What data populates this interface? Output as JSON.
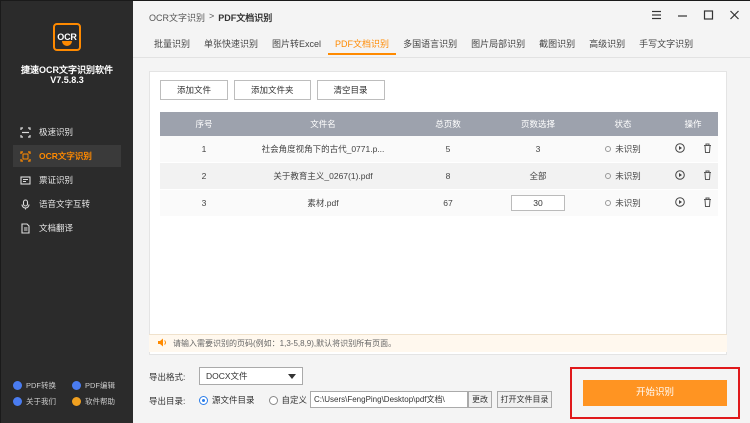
{
  "app": {
    "logo_text": "OCR",
    "name": "捷速OCR文字识别软件",
    "version": "V7.5.8.3"
  },
  "sidebar": {
    "items": [
      {
        "label": "极速识别",
        "icon": "scan-icon",
        "active": false
      },
      {
        "label": "OCR文字识别",
        "icon": "ocr-icon",
        "active": true
      },
      {
        "label": "票证识别",
        "icon": "ticket-icon",
        "active": false
      },
      {
        "label": "语音文字互转",
        "icon": "microphone-icon",
        "active": false
      },
      {
        "label": "文档翻译",
        "icon": "document-icon",
        "active": false
      }
    ],
    "bottom_links": [
      {
        "label": "PDF转换",
        "color": "#4a7cf0"
      },
      {
        "label": "PDF编辑",
        "color": "#4a7cf0"
      },
      {
        "label": "关于我们",
        "color": "#4a7cf0"
      },
      {
        "label": "软件帮助",
        "color": "#f0a020"
      }
    ]
  },
  "breadcrumb": {
    "parent": "OCR文字识别",
    "separator": ">",
    "current": "PDF文档识别"
  },
  "tabs": [
    {
      "label": "批量识别",
      "active": false
    },
    {
      "label": "单张快速识别",
      "active": false
    },
    {
      "label": "图片转Excel",
      "active": false
    },
    {
      "label": "PDF文档识别",
      "active": true
    },
    {
      "label": "多国语言识别",
      "active": false
    },
    {
      "label": "图片局部识别",
      "active": false
    },
    {
      "label": "截图识别",
      "active": false
    },
    {
      "label": "高级识别",
      "active": false
    },
    {
      "label": "手写文字识别",
      "active": false
    }
  ],
  "toolbar": {
    "add_file": "添加文件",
    "add_folder": "添加文件夹",
    "clear_list": "清空目录"
  },
  "table": {
    "headers": {
      "no": "序号",
      "name": "文件名",
      "pages": "总页数",
      "selection": "页数选择",
      "status": "状态",
      "ops": "操作"
    },
    "rows": [
      {
        "no": "1",
        "name": "社会角度视角下的古代_0771.p...",
        "pages": "5",
        "selection": "3",
        "selection_input": false,
        "status": "未识别"
      },
      {
        "no": "2",
        "name": "关于教育主义_0267(1).pdf",
        "pages": "8",
        "selection": "全部",
        "selection_input": false,
        "status": "未识别"
      },
      {
        "no": "3",
        "name": "素材.pdf",
        "pages": "67",
        "selection": "30",
        "selection_input": true,
        "status": "未识别"
      }
    ]
  },
  "hint": {
    "text": "请输入需要识别的页码(例如：1,3-5,8,9),默认将识别所有页面。"
  },
  "output": {
    "format_label": "导出格式:",
    "format_value": "DOCX文件",
    "dir_label": "导出目录:",
    "radio_source": "源文件目录",
    "radio_custom": "自定义",
    "path": "C:\\Users\\FengPing\\Desktop\\pdf文档\\",
    "change_button": "更改",
    "open_button": "打开文件目录"
  },
  "start_button": "开始识别",
  "colors": {
    "accent": "#ff8a00",
    "start": "#ff9422",
    "highlight_border": "#e0191b"
  }
}
